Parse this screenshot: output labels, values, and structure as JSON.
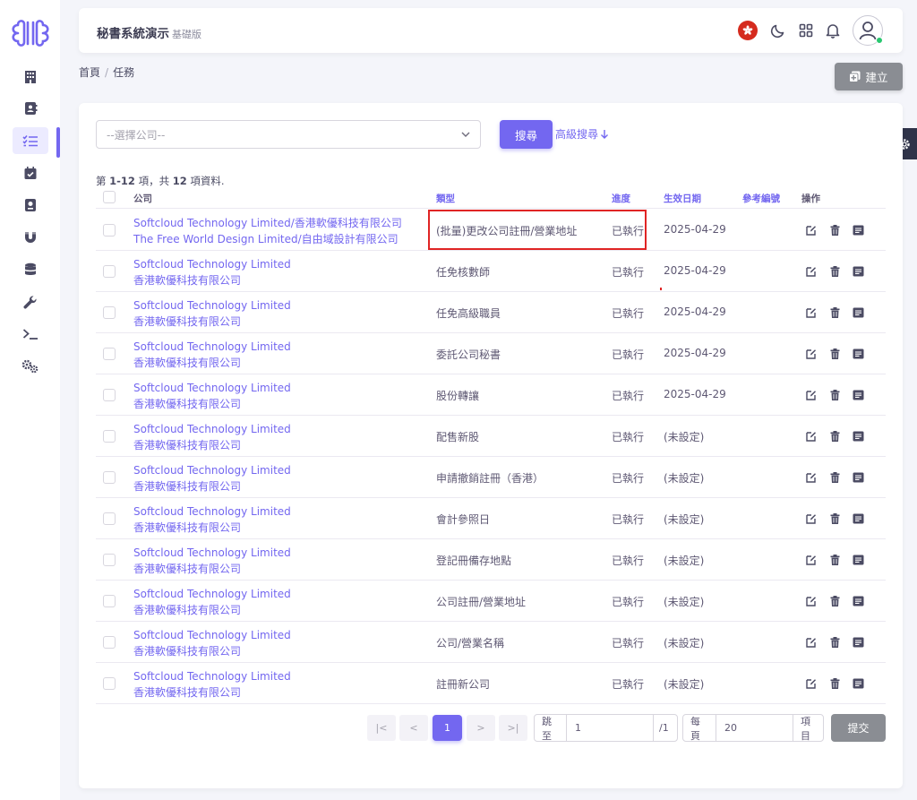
{
  "app": {
    "title": "秘書系統演示",
    "edition": "基礎版"
  },
  "colors": {
    "primary": "#7367f0",
    "secondary": "#8a8d93",
    "danger": "#e02424",
    "dark": "#2f3349"
  },
  "sidebar": {
    "items": [
      {
        "icon": "building-icon",
        "active": false
      },
      {
        "icon": "contact-book-icon",
        "active": false
      },
      {
        "icon": "checklist-icon",
        "active": true
      },
      {
        "icon": "calendar-check-icon",
        "active": false
      },
      {
        "icon": "notebook-icon",
        "active": false
      },
      {
        "icon": "magnet-icon",
        "active": false
      },
      {
        "icon": "database-icon",
        "active": false
      },
      {
        "icon": "wrench-icon",
        "active": false
      },
      {
        "icon": "terminal-icon",
        "active": false
      },
      {
        "icon": "cogs-icon",
        "active": false
      }
    ]
  },
  "topbar": {
    "icons": [
      "hk-flag-icon",
      "moon-icon",
      "grid-icon",
      "bell-icon",
      "user-avatar-icon"
    ]
  },
  "breadcrumb": {
    "home": "首頁",
    "separator": "/",
    "current": "任務"
  },
  "create_button": "建立",
  "filter": {
    "company_placeholder": "--選擇公司--",
    "search_label": "搜尋",
    "advanced_search_label": "高級搜尋"
  },
  "summary": {
    "prefix": "第 ",
    "range": "1-12",
    "middle": " 項，共 ",
    "total": "12",
    "suffix": " 項資料."
  },
  "table": {
    "headers": {
      "company": "公司",
      "type": "類型",
      "status": "進度",
      "effective_date": "生效日期",
      "ref_no": "參考編號",
      "actions": "操作"
    },
    "rows": [
      {
        "company_line1": "Softcloud Technology Limited/香港軟優科技有限公司",
        "company_line2": "The Free World Design Limited/自由域設計有限公司",
        "type": "(批量)更改公司註冊/營業地址",
        "status": "已執行",
        "date": "2025-04-29"
      },
      {
        "company_line1": "Softcloud Technology Limited",
        "company_line2": "香港軟優科技有限公司",
        "type": "任免核數師",
        "status": "已執行",
        "date": "2025-04-29"
      },
      {
        "company_line1": "Softcloud Technology Limited",
        "company_line2": "香港軟優科技有限公司",
        "type": "任免高級職員",
        "status": "已執行",
        "date": "2025-04-29"
      },
      {
        "company_line1": "Softcloud Technology Limited",
        "company_line2": "香港軟優科技有限公司",
        "type": "委託公司秘書",
        "status": "已執行",
        "date": "2025-04-29"
      },
      {
        "company_line1": "Softcloud Technology Limited",
        "company_line2": "香港軟優科技有限公司",
        "type": "股份轉讓",
        "status": "已執行",
        "date": "2025-04-29"
      },
      {
        "company_line1": "Softcloud Technology Limited",
        "company_line2": "香港軟優科技有限公司",
        "type": "配售新股",
        "status": "已執行",
        "date": "(未設定)"
      },
      {
        "company_line1": "Softcloud Technology Limited",
        "company_line2": "香港軟優科技有限公司",
        "type": "申請撤銷註冊（香港）",
        "status": "已執行",
        "date": "(未設定)"
      },
      {
        "company_line1": "Softcloud Technology Limited",
        "company_line2": "香港軟優科技有限公司",
        "type": "會計參照日",
        "status": "已執行",
        "date": "(未設定)"
      },
      {
        "company_line1": "Softcloud Technology Limited",
        "company_line2": "香港軟優科技有限公司",
        "type": "登記冊備存地點",
        "status": "已執行",
        "date": "(未設定)"
      },
      {
        "company_line1": "Softcloud Technology Limited",
        "company_line2": "香港軟優科技有限公司",
        "type": "公司註冊/營業地址",
        "status": "已執行",
        "date": "(未設定)"
      },
      {
        "company_line1": "Softcloud Technology Limited",
        "company_line2": "香港軟優科技有限公司",
        "type": "公司/營業名稱",
        "status": "已執行",
        "date": "(未設定)"
      },
      {
        "company_line1": "Softcloud Technology Limited",
        "company_line2": "香港軟優科技有限公司",
        "type": "註冊新公司",
        "status": "已執行",
        "date": "(未設定)"
      }
    ]
  },
  "pagination": {
    "first": "|<",
    "prev": "<",
    "current": "1",
    "next": ">",
    "last": ">|",
    "goto_label": "跳至",
    "goto_value": "1",
    "total_pages": "/1",
    "per_page_label": "每頁",
    "per_page_value": "20",
    "items_label": "項目",
    "submit_label": "提交"
  }
}
